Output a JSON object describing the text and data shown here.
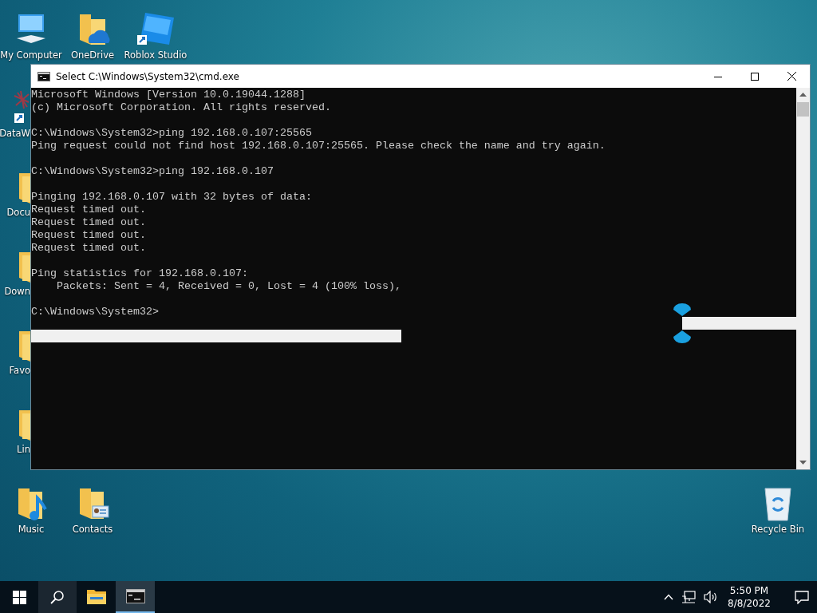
{
  "desktop_icons": [
    {
      "label": "My Computer",
      "kind": "computer"
    },
    {
      "label": "OneDrive",
      "kind": "onedrive"
    },
    {
      "label": "Roblox Studio",
      "kind": "roblox"
    },
    {
      "label": "DataW",
      "kind": "app-shortcut"
    },
    {
      "label": "Docu",
      "kind": "folder"
    },
    {
      "label": "Down",
      "kind": "folder"
    },
    {
      "label": "Favo",
      "kind": "folder"
    },
    {
      "label": "Lin",
      "kind": "folder"
    },
    {
      "label": "Music",
      "kind": "music-folder"
    },
    {
      "label": "Contacts",
      "kind": "contacts-folder"
    },
    {
      "label": "Recycle Bin",
      "kind": "recycle-bin"
    }
  ],
  "window": {
    "title": "Select C:\\Windows\\System32\\cmd.exe",
    "console": [
      [
        "Microsoft Windows [Version 10.0.19044.1288]",
        "(c) Microsoft Corporation. All rights reserved."
      ],
      [
        "C:\\Windows\\System32>ping 192.168.0.107:25565",
        "Ping request could not find host 192.168.0.107:25565. Please check the name and try again."
      ],
      [
        "C:\\Windows\\System32>ping 192.168.0.107"
      ],
      [
        "Pinging 192.168.0.107 with 32 bytes of data:",
        "Request timed out.",
        "Request timed out.",
        "Request timed out.",
        "Request timed out."
      ],
      [
        "Ping statistics for 192.168.0.107:",
        "    Packets: Sent = 4, Received = 0, Lost = 4 (100% loss),"
      ],
      [
        "C:\\Windows\\System32>"
      ]
    ]
  },
  "taskbar": {
    "apps": [
      {
        "kind": "explorer",
        "selected": false
      },
      {
        "kind": "cmd",
        "selected": true
      }
    ],
    "time": "5:50 PM",
    "date": "8/8/2022"
  }
}
